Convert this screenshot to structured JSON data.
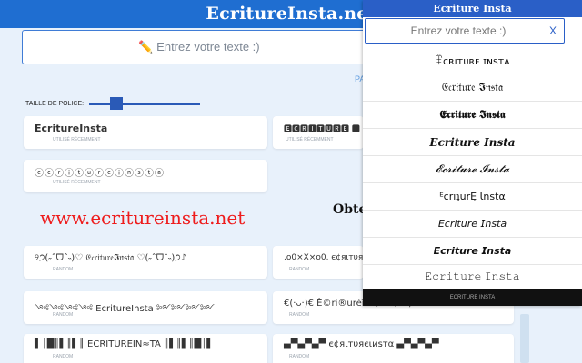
{
  "site_title": "EcritureInsta.net",
  "main_input": {
    "placeholder": "✏️ Entrez votre texte :)"
  },
  "par_link": "PA",
  "font_size_label": "TAILLE DE POLICE:",
  "recent_cards": [
    {
      "text": "EcritureInsta",
      "sub": "UTILISÉ RÉCEMMENT"
    },
    {
      "text": "🅴🅲🆁🅸🆃🆄🆁🅴 🅸",
      "sub": "UTILISÉ RÉCEMMENT"
    },
    {
      "text": "ⓔⓒⓡⓘⓣⓤⓡⓔⓘⓝⓢⓣⓐ",
      "sub": "UTILISÉ RÉCEMMENT"
    }
  ],
  "watermark": "www.ecritureinsta.net",
  "obte_text": "Obte",
  "random_cards": [
    {
      "text": "୨੭(˶ˆᗜˆ˵)♡ 𝔈𝔠𝔯𝔦𝔱𝔲𝔯𝔢𝕴𝔫𝔰𝔱𝔞 ♡(˶ˆᗜˆ˵)੭♪",
      "sub": "RANDOM"
    },
    {
      "text": ".o0×X×o0. є¢яιтυяєιиѕтα",
      "sub": "RANDOM"
    },
    {
      "text": "༺༺༺༺ EcritureInsta ༻༻༻༻",
      "sub": "RANDOM"
    },
    {
      "text": "€(·ᴗ·)€ È©ri®uréîns†a €(·ᴗ·)",
      "sub": "RANDOM"
    },
    {
      "text": "▌│█║▌║▌║ ECRITUREIN≈TA ║▌║▌║█│▌",
      "sub": "RANDOM"
    },
    {
      "text": "▄▀▄▀▄▀ є¢яιтυяєιиѕтα ▄▀▄▀▄▀",
      "sub": "RANDOM"
    }
  ],
  "popup": {
    "header": "Ecriture Insta",
    "input_placeholder": "Entrez votre texte :)",
    "close_label": "X",
    "items": [
      "ꁺᴄʀıᴛᴜʀᴇ ɪɴsᴛᴀ",
      "𝔈𝔠𝔯𝔦𝔱𝔲𝔯𝔢 𝕴𝔫𝔰𝔱𝔞",
      "𝕰𝖈𝖗𝖎𝖙𝖚𝖗𝖊 𝕴𝖓𝖘𝖙𝖆",
      "𝑬𝒄𝒓𝒊𝒕𝒖𝒓𝒆 𝑰𝒏𝒔𝒕𝒂",
      "𝓔𝓬𝓻𝓲𝓽𝓾𝓻𝓮 𝓘𝓷𝓼𝓽𝓪",
      "ᴱcrıʇurĘ Ɩnstα",
      "𝘌𝘤𝘳𝘪𝘵𝘶𝘳𝘦 𝘐𝘯𝘴𝘵𝘢",
      "𝙀𝙘𝙧𝙞𝙩𝙪𝙧𝙚 𝙄𝙣𝙨𝙩𝙖",
      "𝙴𝚌𝚛𝚒𝚝𝚞𝚛𝚎 𝙸𝚗𝚜𝚝𝚊"
    ],
    "footer": "ECRITURE INSTA"
  }
}
